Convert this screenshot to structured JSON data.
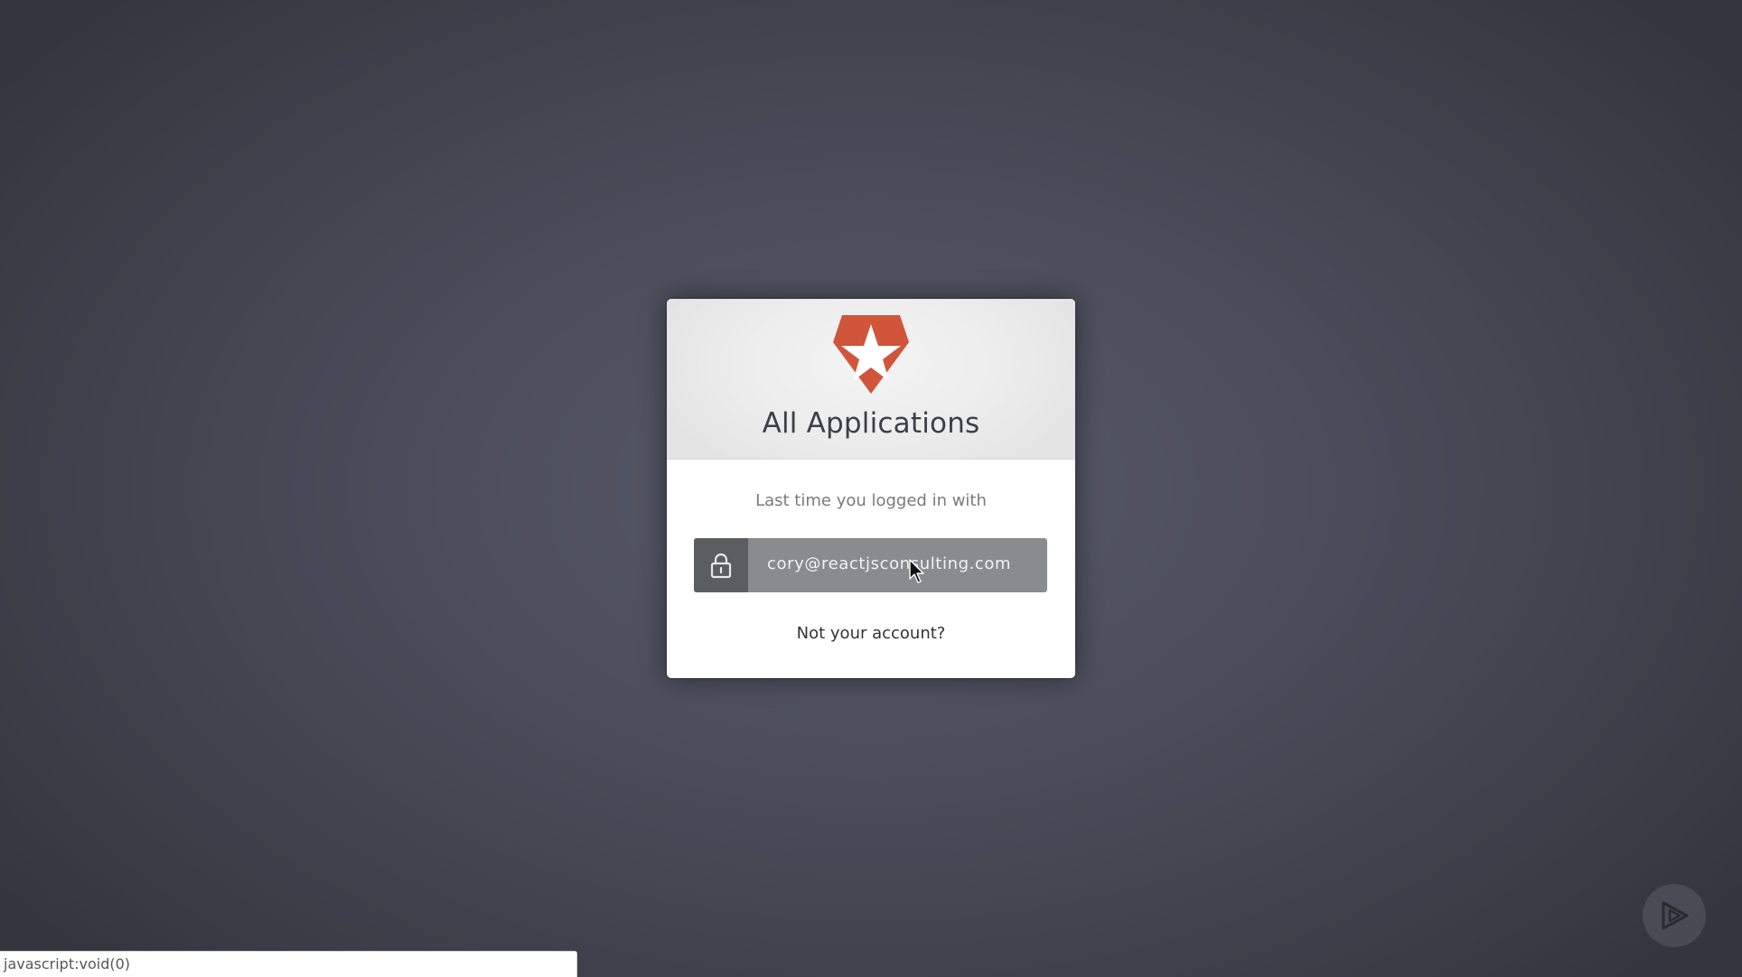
{
  "lock": {
    "logo_icon": "shield-star-logo",
    "title": "All Applications",
    "last_login_text": "Last time you logged in with",
    "account": {
      "icon": "lock-icon",
      "email": "cory@reactjsconsulting.com"
    },
    "not_your_account": "Not your account?"
  },
  "overlay": {
    "play_icon": "play-icon"
  },
  "status_bar": {
    "text": "javascript:void(0)"
  },
  "colors": {
    "brand": "#d0553a",
    "background": "#4a4c59",
    "account_button": "#8a8b8e",
    "account_icon_box": "#5c5d61"
  }
}
